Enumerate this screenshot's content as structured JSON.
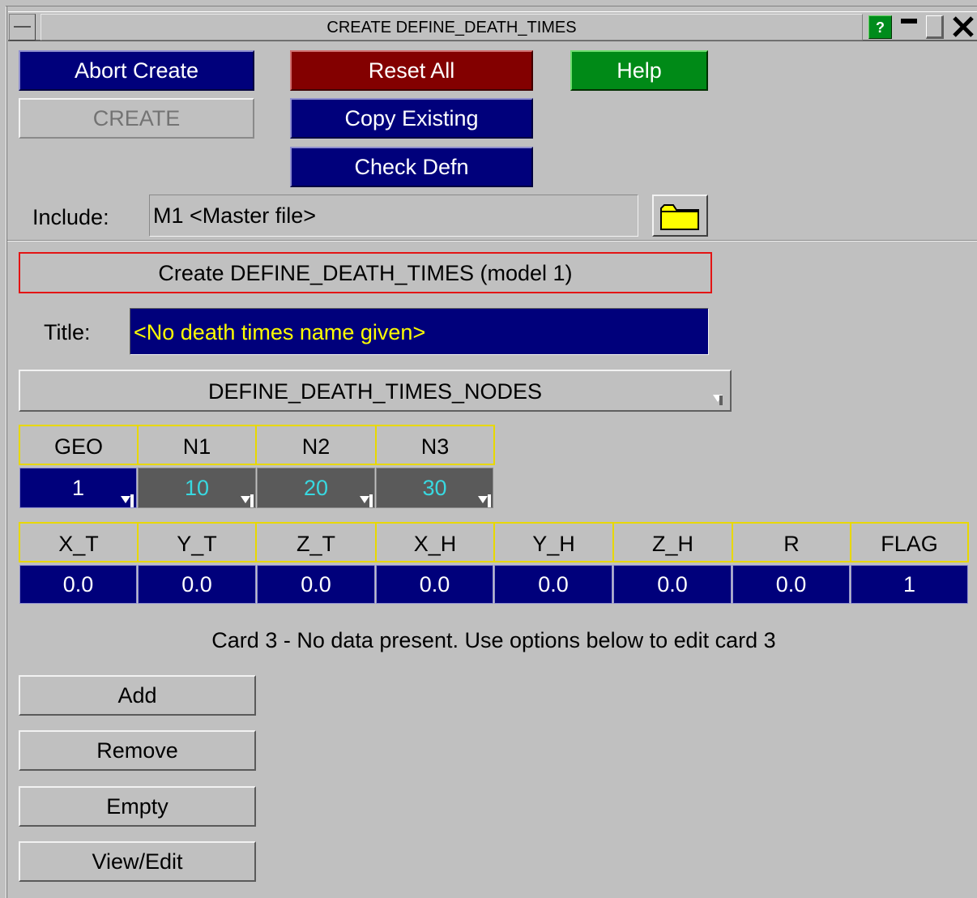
{
  "window": {
    "title": "CREATE DEFINE_DEATH_TIMES",
    "help_icon": "?",
    "close_icon": "✕"
  },
  "toolbar": {
    "abort_create": "Abort Create",
    "reset_all": "Reset All",
    "help": "Help",
    "create": "CREATE",
    "copy_existing": "Copy Existing",
    "check_defn": "Check Defn"
  },
  "include": {
    "label": "Include:",
    "value": "M1  <Master file>",
    "folder_icon": "folder-icon"
  },
  "main": {
    "header": "Create DEFINE_DEATH_TIMES (model 1)",
    "title_label": "Title:",
    "title_value": "<No death times name given>",
    "option": "DEFINE_DEATH_TIMES_NODES"
  },
  "card1": {
    "headers": [
      "GEO",
      "N1",
      "N2",
      "N3"
    ],
    "values": [
      "1",
      "10",
      "20",
      "30"
    ]
  },
  "card2": {
    "headers": [
      "X_T",
      "Y_T",
      "Z_T",
      "X_H",
      "Y_H",
      "Z_H",
      "R",
      "FLAG"
    ],
    "values": [
      "0.0",
      "0.0",
      "0.0",
      "0.0",
      "0.0",
      "0.0",
      "0.0",
      "1"
    ]
  },
  "card3": {
    "message": "Card 3 - No data present. Use options below to edit card 3"
  },
  "actions": {
    "add": "Add",
    "remove": "Remove",
    "empty": "Empty",
    "view_edit": "View/Edit"
  },
  "colors": {
    "background": "#c0c0c0",
    "blue_button": "#00007b",
    "red_button": "#830000",
    "green_button": "#008a17",
    "title_text": "#ffff00",
    "linked_value_text": "#38d8e0",
    "header_border": "#e8d800"
  }
}
